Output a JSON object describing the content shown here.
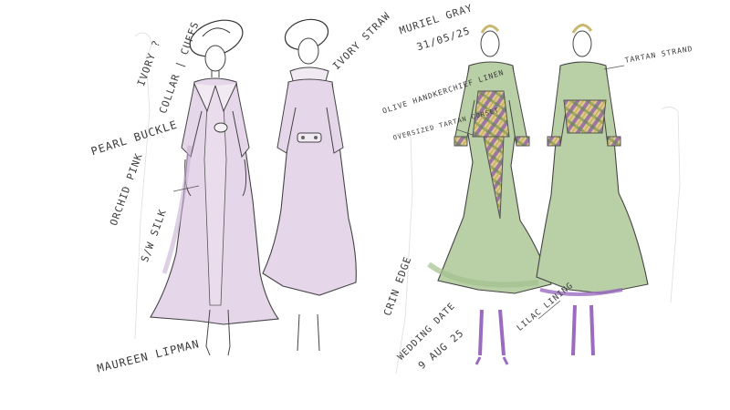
{
  "sketch_left": {
    "notes": {
      "ivory_collar": "IVORY ?",
      "collar_cuffs": "COLLAR | CUFFS",
      "pearl_buckle": "PEARL BUCKLE",
      "orchid_pink": "ORCHID PINK",
      "silk": "S/W SILK",
      "name": "MAUREEN LIPMAN",
      "ivory_straw": "IVORY STRAW"
    },
    "colors": {
      "coat": "#e6d6ea",
      "coat_shade": "#d8c2df"
    }
  },
  "sketch_right": {
    "notes": {
      "name": "MURIEL GRAY",
      "date": "31/05/25",
      "dress": "OLIVE HANDKERCHIEF LINEN",
      "tartan_corset": "OVERSIZED TARTAN CORSET",
      "crin": "CRIN EDGE",
      "wedding": "WEDDING DATE",
      "wedding_date": "9 AUG 25",
      "lilac_lining": "LILAC LINING",
      "tartan_strand": "TARTAN STRAND"
    },
    "colors": {
      "dress": "#b9cfa6",
      "dress_shade": "#a3bf8e",
      "tartan_purple": "#8c5aa8",
      "tartan_gold": "#c9a94a",
      "lilac": "#9b6bc0"
    }
  }
}
